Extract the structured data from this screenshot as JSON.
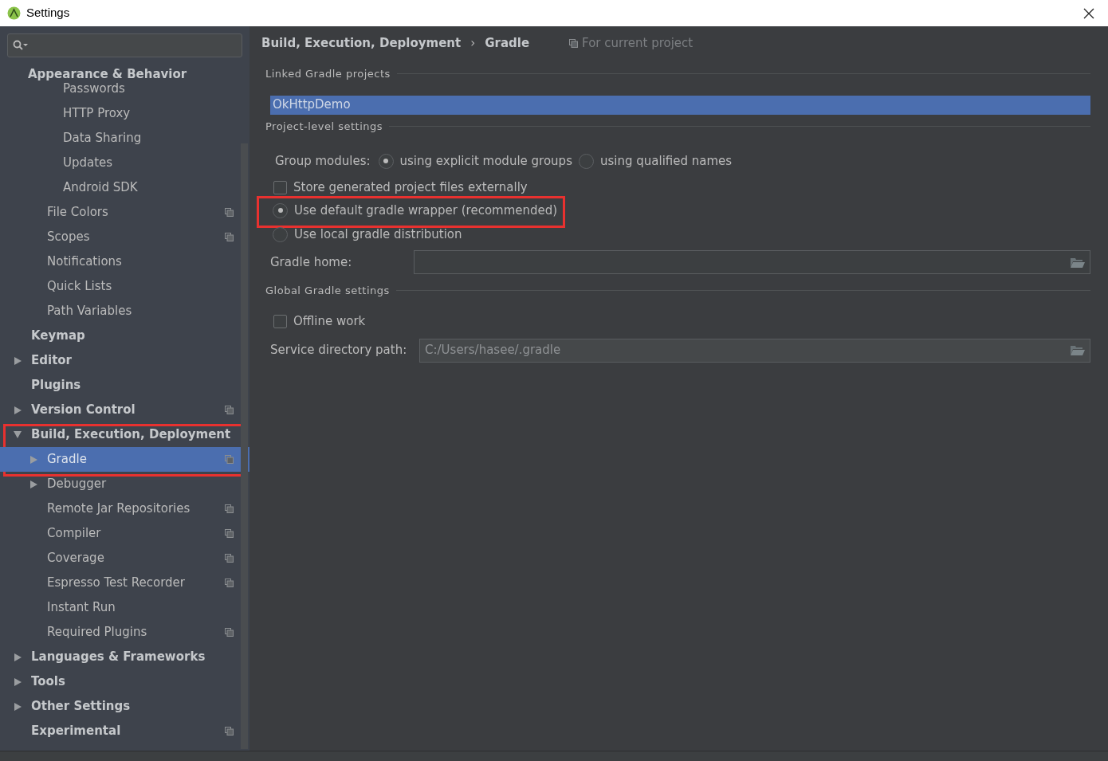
{
  "window": {
    "title": "Settings"
  },
  "sidebar": {
    "header": "Appearance & Behavior",
    "items": [
      {
        "children": [
          {
            "label": "Passwords"
          },
          {
            "label": "HTTP Proxy"
          },
          {
            "label": "Data Sharing"
          },
          {
            "label": "Updates"
          },
          {
            "label": "Android SDK"
          }
        ]
      },
      {
        "label": "File Colors",
        "project_icon": true
      },
      {
        "label": "Scopes",
        "project_icon": true
      },
      {
        "label": "Notifications"
      },
      {
        "label": "Quick Lists"
      },
      {
        "label": "Path Variables"
      },
      {
        "label": "Keymap",
        "top": true
      },
      {
        "label": "Editor",
        "top": true,
        "expandable": true,
        "expanded": false
      },
      {
        "label": "Plugins",
        "top": true
      },
      {
        "label": "Version Control",
        "top": true,
        "expandable": true,
        "expanded": false,
        "project_icon": true
      },
      {
        "label": "Build, Execution, Deployment",
        "top": true,
        "expandable": true,
        "expanded": true,
        "highlighted": true,
        "children": [
          {
            "label": "Gradle",
            "expandable": true,
            "expanded": false,
            "selected": true,
            "project_icon": true
          },
          {
            "label": "Debugger",
            "expandable": true,
            "expanded": false,
            "selected": false
          },
          {
            "label": "Remote Jar Repositories",
            "project_icon": true,
            "selected": false
          },
          {
            "label": "Compiler",
            "project_icon": true,
            "selected": false
          },
          {
            "label": "Coverage",
            "project_icon": true,
            "selected": false
          },
          {
            "label": "Espresso Test Recorder",
            "project_icon": true,
            "selected": false
          },
          {
            "label": "Instant Run",
            "selected": false
          },
          {
            "label": "Required Plugins",
            "project_icon": true,
            "selected": false
          }
        ]
      },
      {
        "label": "Languages & Frameworks",
        "top": true,
        "expandable": true,
        "expanded": false
      },
      {
        "label": "Tools",
        "top": true,
        "expandable": true,
        "expanded": false
      },
      {
        "label": "Other Settings",
        "top": true,
        "expandable": true,
        "expanded": false
      },
      {
        "label": "Experimental",
        "top": true,
        "project_icon": true
      }
    ]
  },
  "breadcrumb": {
    "parent": "Build, Execution, Deployment",
    "separator": "›",
    "current": "Gradle",
    "scope": "For current project"
  },
  "linked": {
    "title": "Linked Gradle projects",
    "projects": [
      {
        "name": "OkHttpDemo",
        "selected": true
      }
    ]
  },
  "project_settings": {
    "title": "Project-level settings",
    "group_modules": {
      "label": "Group modules:",
      "options": [
        {
          "label": "using explicit module groups",
          "selected": true
        },
        {
          "label": "using qualified names",
          "selected": false
        }
      ]
    },
    "store_externally": {
      "label": "Store generated project files externally",
      "checked": false
    },
    "distribution": [
      {
        "label": "Use default gradle wrapper (recommended)",
        "selected": true,
        "highlighted": true
      },
      {
        "label": "Use local gradle distribution",
        "selected": false,
        "highlighted": false
      }
    ],
    "gradle_home": {
      "label": "Gradle home:"
    }
  },
  "global_settings": {
    "title": "Global Gradle settings",
    "offline": {
      "label": "Offline work",
      "checked": false
    },
    "service_dir": {
      "label": "Service directory path:",
      "value": "C:/Users/hasee/.gradle"
    }
  }
}
